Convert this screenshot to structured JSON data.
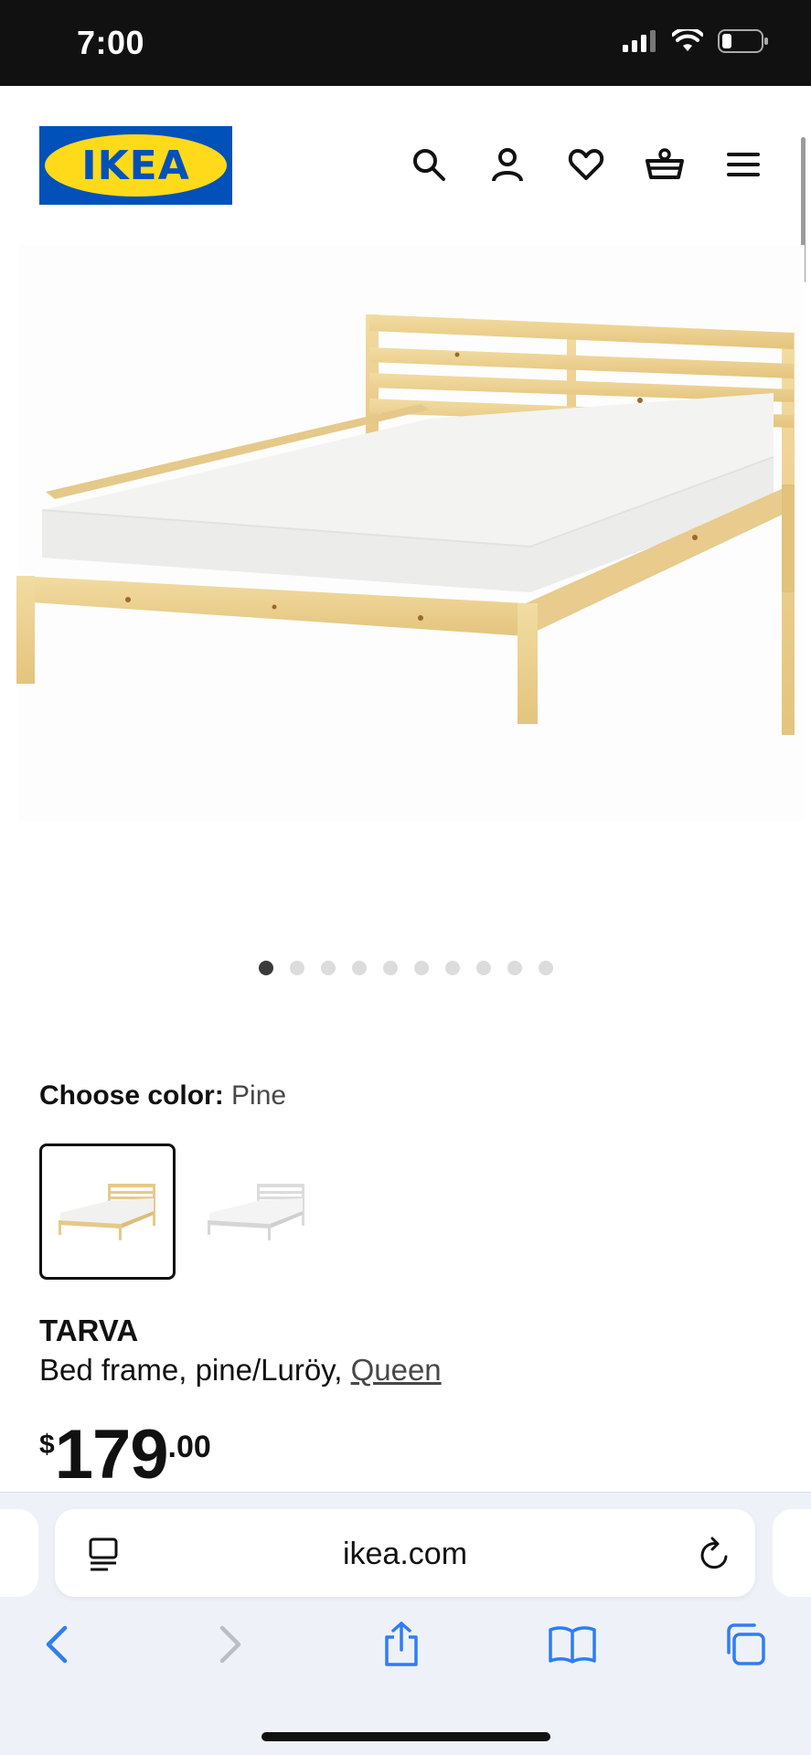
{
  "status_bar": {
    "time": "7:00"
  },
  "header": {
    "logo_text": "IKEA",
    "icons": [
      "search-icon",
      "user-icon",
      "heart-icon",
      "cart-icon",
      "menu-icon"
    ]
  },
  "gallery": {
    "total_images": 10,
    "active_index": 0
  },
  "color_chooser": {
    "label": "Choose color:",
    "selected_value": "Pine",
    "options": [
      "Pine",
      "White"
    ]
  },
  "product": {
    "name": "TARVA",
    "description_prefix": "Bed frame, pine/Luröy, ",
    "size": "Queen",
    "price": {
      "currency": "$",
      "integer": "179",
      "decimal": ".00"
    }
  },
  "browser": {
    "url": "ikea.com",
    "toolbar_icons": [
      "back-icon",
      "forward-icon",
      "share-icon",
      "bookmarks-icon",
      "tabs-icon"
    ]
  },
  "colors": {
    "ikea_blue": "#0051ba",
    "ikea_yellow": "#ffda1a",
    "ios_blue": "#2f7cf6"
  }
}
